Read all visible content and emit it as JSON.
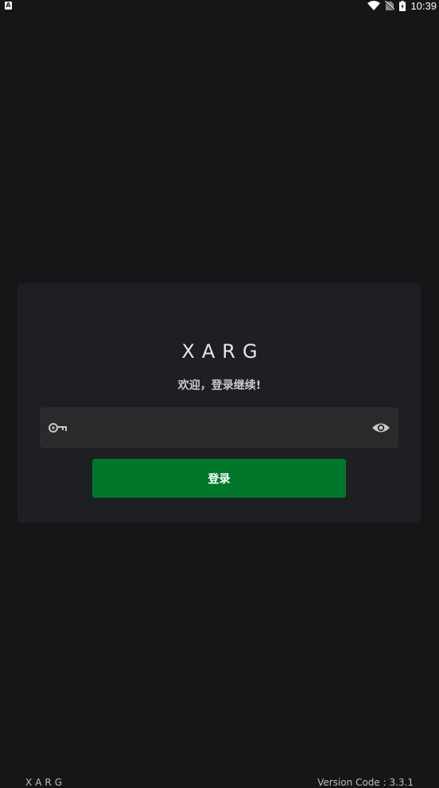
{
  "status_bar": {
    "badge": "A",
    "time": "10:39",
    "icons": [
      "wifi-icon",
      "no-sim-icon",
      "battery-charging-icon"
    ]
  },
  "login": {
    "app_name": "XARG",
    "welcome": "欢迎，登录继续!",
    "password_value": "",
    "password_placeholder": "",
    "key_icon": "key-icon",
    "visibility_icon": "eye-icon",
    "submit_label": "登录"
  },
  "footer": {
    "brand": "XARG",
    "version": "Version Code : 3.3.1"
  },
  "colors": {
    "background": "#151618",
    "card": "#1e1f22",
    "field": "#2a2a2c",
    "accent": "#01772b"
  }
}
